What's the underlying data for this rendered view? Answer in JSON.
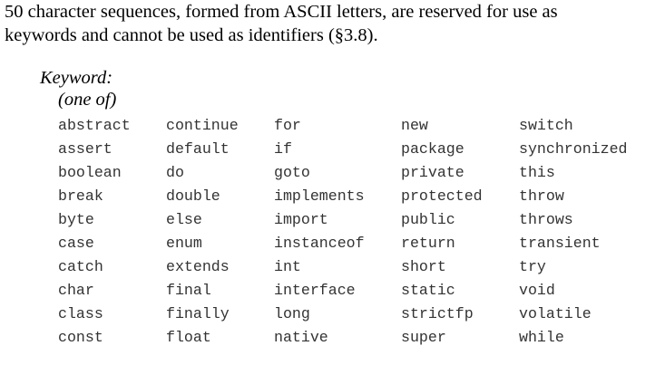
{
  "intro": {
    "line1": "50 character sequences, formed from ASCII letters, are reserved for use as",
    "line2": "keywords and cannot be used as identifiers (§3.8)."
  },
  "grammar": {
    "head": "Keyword:",
    "one_of": "(one of)"
  },
  "keywords": [
    "abstract",
    "assert",
    "boolean",
    "break",
    "byte",
    "case",
    "catch",
    "char",
    "class",
    "const",
    "continue",
    "default",
    "do",
    "double",
    "else",
    "enum",
    "extends",
    "final",
    "finally",
    "float",
    "for",
    "if",
    "goto",
    "implements",
    "import",
    "instanceof",
    "int",
    "interface",
    "long",
    "native",
    "new",
    "package",
    "private",
    "protected",
    "public",
    "return",
    "short",
    "static",
    "strictfp",
    "super",
    "switch",
    "synchronized",
    "this",
    "throw",
    "throws",
    "transient",
    "try",
    "void",
    "volatile",
    "while"
  ]
}
